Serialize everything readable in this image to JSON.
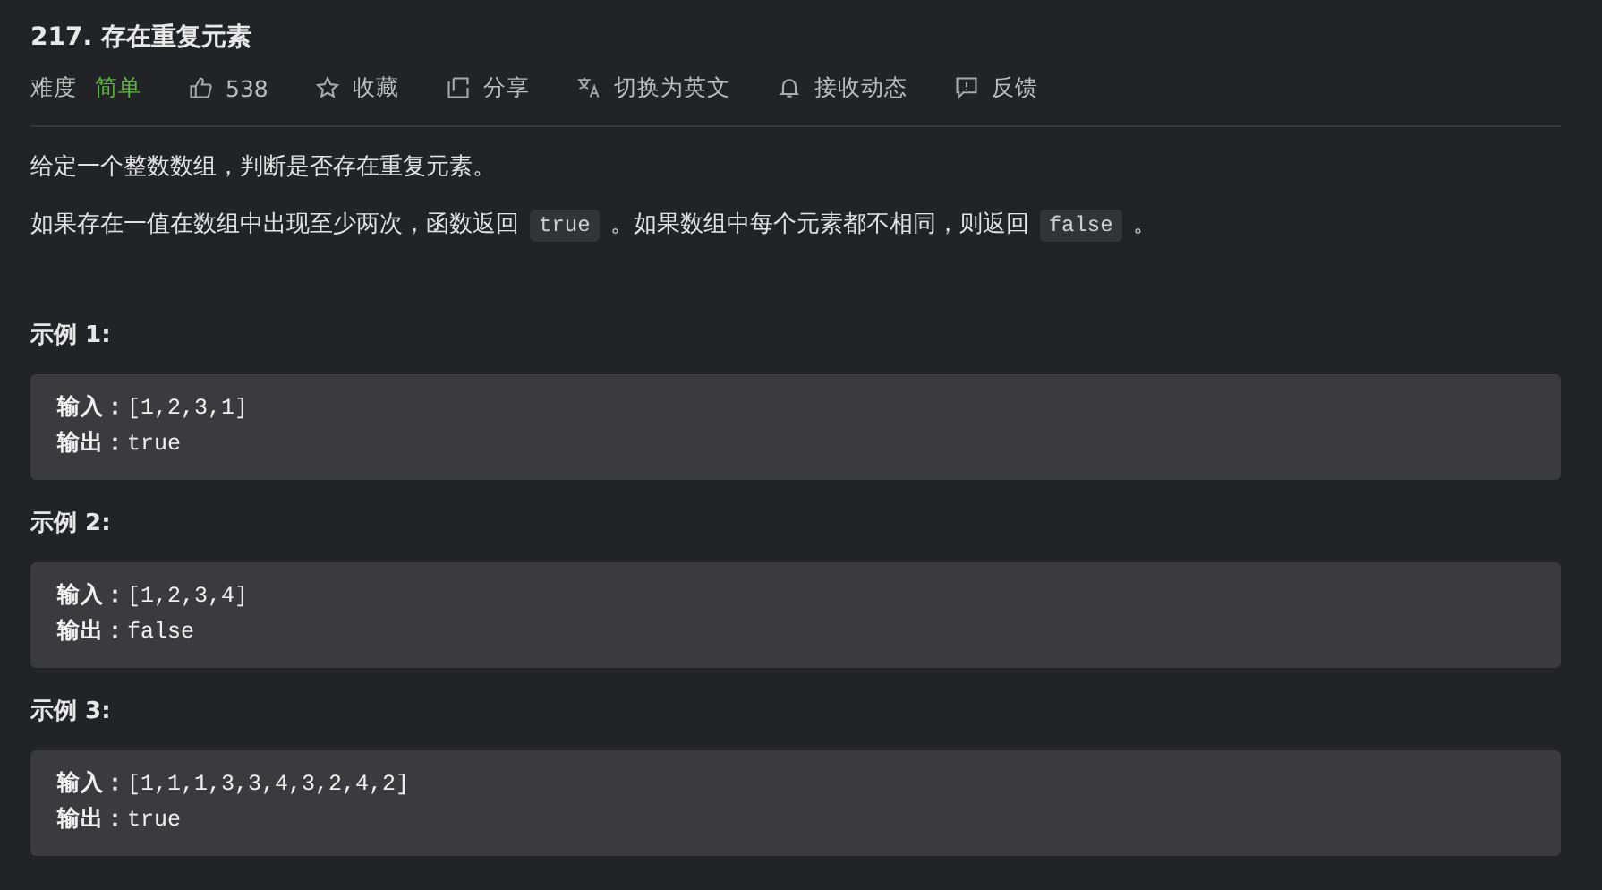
{
  "title": "217. 存在重复元素",
  "meta": {
    "difficulty_label": "难度",
    "difficulty": "简单",
    "actions": [
      {
        "kind": "like",
        "label": "538"
      },
      {
        "kind": "star",
        "label": "收藏"
      },
      {
        "kind": "share",
        "label": "分享"
      },
      {
        "kind": "translate",
        "label": "切换为英文"
      },
      {
        "kind": "bell",
        "label": "接收动态"
      },
      {
        "kind": "feedback",
        "label": "反馈"
      }
    ]
  },
  "description": [
    [
      {
        "kind": "text",
        "text": "给定一个整数数组，判断是否存在重复元素。"
      }
    ],
    [
      {
        "kind": "text",
        "text": "如果存在一值在数组中出现至少两次，函数返回"
      },
      {
        "kind": "code",
        "text": "true"
      },
      {
        "kind": "text",
        "text": "。如果数组中每个元素都不相同，则返回"
      },
      {
        "kind": "code",
        "text": "false"
      },
      {
        "kind": "text",
        "text": "。"
      }
    ]
  ],
  "examples": [
    {
      "heading": "示例 1:",
      "lines": [
        "**输入：**[1,2,3,1]",
        "**输出：**true"
      ]
    },
    {
      "heading": "示例 2:",
      "lines": [
        "**输入：**[1,2,3,4]",
        "**输出：**false"
      ]
    },
    {
      "heading": "示例 3:",
      "lines": [
        "**输入：**[1,1,1,3,3,4,3,2,4,2]",
        "**输出：**true"
      ]
    }
  ]
}
